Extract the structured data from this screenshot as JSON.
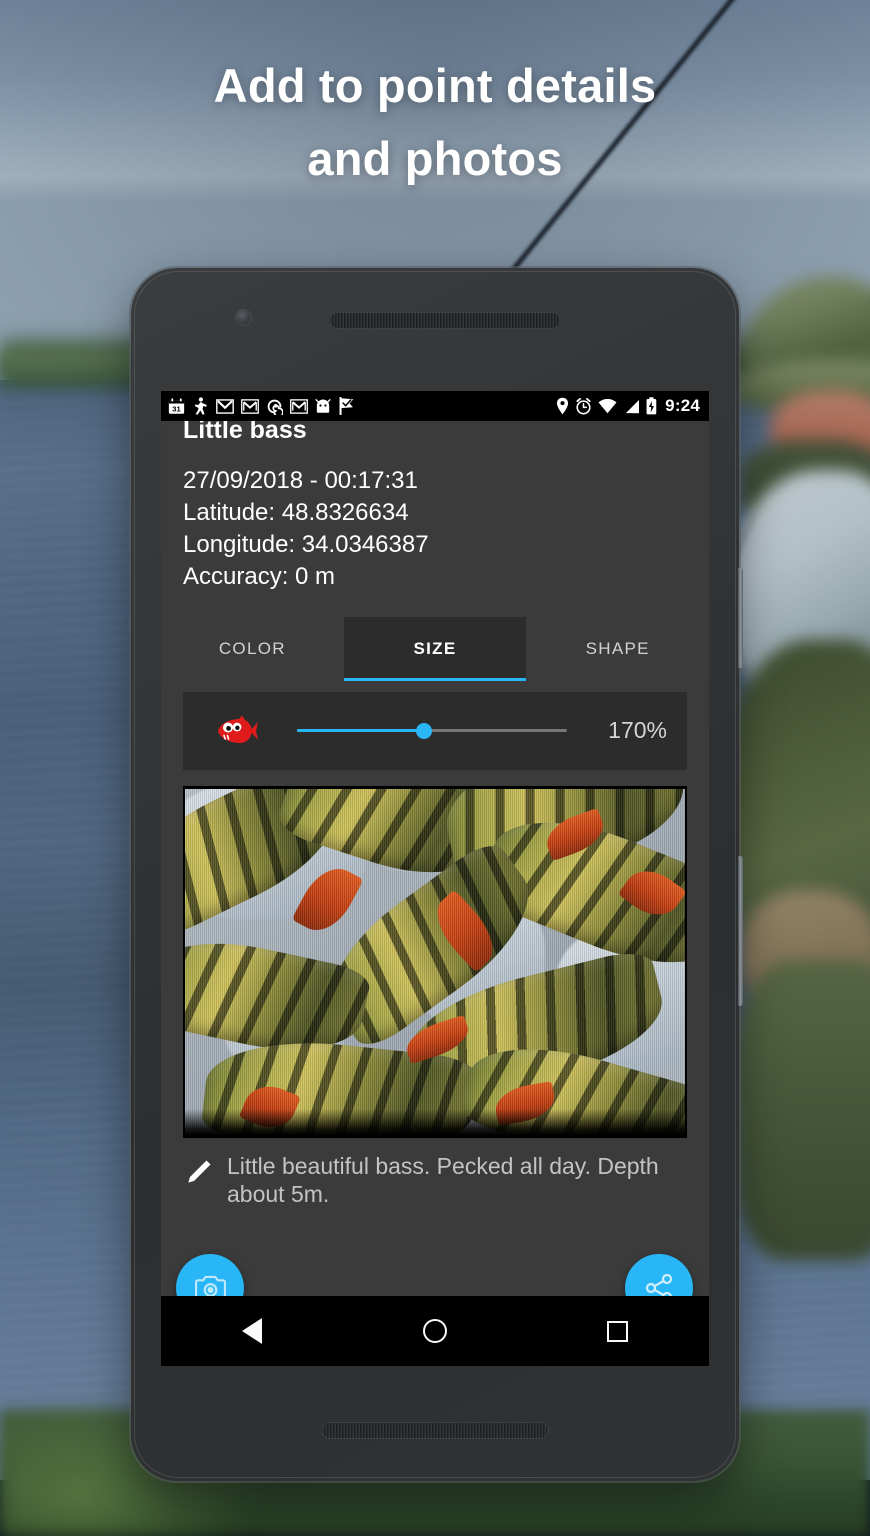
{
  "promo": {
    "headline_line1": "Add to point details",
    "headline_line2": "and photos"
  },
  "statusbar": {
    "time": "9:24",
    "left_icons": [
      "calendar-icon",
      "person-running-icon",
      "gmail-icon",
      "gmail-boxed-icon",
      "spiral-icon",
      "gmail-boxed-2-icon",
      "android-head-icon",
      "check-flag-icon"
    ],
    "right_icons": [
      "location-pin-icon",
      "alarm-clock-icon",
      "wifi-icon",
      "cell-signal-icon",
      "battery-charging-icon"
    ],
    "calendar_day": "31"
  },
  "point": {
    "title": "Little bass",
    "datetime": "27/09/2018 - 00:17:31",
    "latitude": "Latitude: 48.8326634",
    "longitude": "Longitude: 34.0346387",
    "accuracy": "Accuracy: 0 m"
  },
  "tabs": [
    {
      "label": "COLOR",
      "active": false
    },
    {
      "label": "SIZE",
      "active": true
    },
    {
      "label": "SHAPE",
      "active": false
    }
  ],
  "size_control": {
    "icon": "red-fish-icon",
    "value_label": "170%",
    "value_percent": 170,
    "slider_fill_fraction": 0.47
  },
  "photo": {
    "alt_description": "Caught perch fish lying on ice",
    "caption": "Little beautiful bass. Pecked all day. Depth about 5m.",
    "edit_icon": "pencil-icon"
  },
  "actions": {
    "camera_fab": "camera-icon",
    "share_fab": "share-icon"
  },
  "navbar": {
    "back": "back-triangle-icon",
    "home": "home-circle-icon",
    "recents": "recents-square-icon"
  },
  "colors": {
    "accent": "#29b6f6",
    "screen_bg": "#3b3b3b",
    "card_bg": "#2c2c2c",
    "statusbar_bg": "#000000",
    "fish_red": "#e01b1b"
  }
}
